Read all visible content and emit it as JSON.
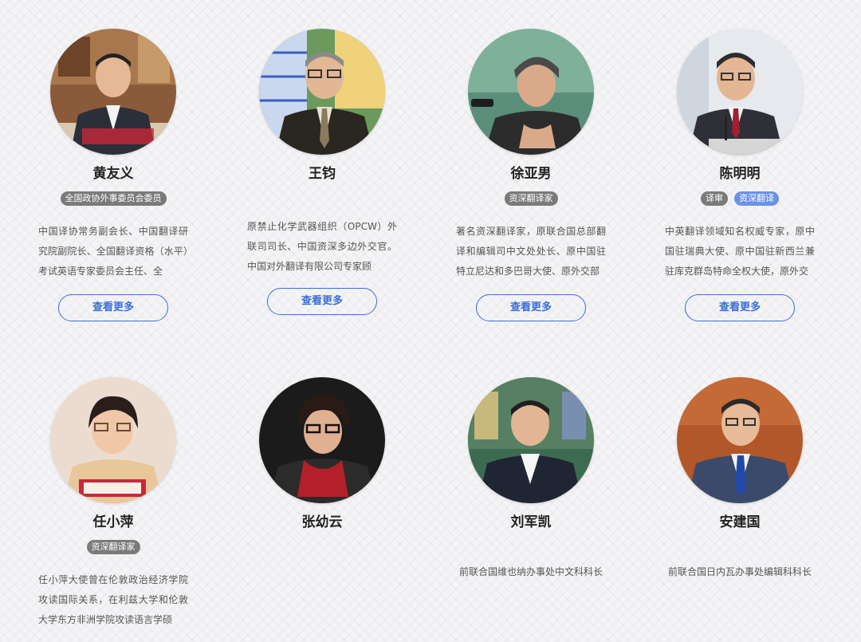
{
  "experts": [
    {
      "name": "黄友义",
      "tags": [
        "全国政协外事委员会委员"
      ],
      "description": "中国译协常务副会长、中国翻译研究院副院长、全国翻译资格（水平）考试英语专家委员会主任、全",
      "button": "查看更多"
    },
    {
      "name": "王钧",
      "tags": [],
      "description": "原禁止化学武器组织（OPCW）外联司司长、中国资深多边外交官。中国对外翻译有限公司专家顾",
      "button": "查看更多"
    },
    {
      "name": "徐亚男",
      "tags": [
        "资深翻译家"
      ],
      "description": "著名资深翻译家，原联合国总部翻译和编辑司中文处处长、原中国驻特立尼达和多巴哥大使、原外交部",
      "button": "查看更多"
    },
    {
      "name": "陈明明",
      "tags": [
        "译审",
        "资深翻译"
      ],
      "description": "中英翻译领域知名权威专家，原中国驻瑞典大使、原中国驻新西兰兼驻库克群岛特命全权大使，原外交",
      "button": "查看更多"
    },
    {
      "name": "任小萍",
      "tags": [
        "资深翻译家"
      ],
      "description": "任小萍大使曾在伦敦政治经济学院攻读国际关系，在利兹大学和伦敦大学东方非洲学院攻读语言学硕"
    },
    {
      "name": "张幼云",
      "tags": [],
      "description": ""
    },
    {
      "name": "刘军凯",
      "tags": [],
      "description": "前联合国维也纳办事处中文科科长"
    },
    {
      "name": "安建国",
      "tags": [],
      "description": "前联合国日内瓦办事处编辑科科长"
    }
  ],
  "colors": {
    "accent": "#3a6fd8",
    "tag_gray": "#7a7a7a",
    "tag_blue": "#6a92e6"
  }
}
